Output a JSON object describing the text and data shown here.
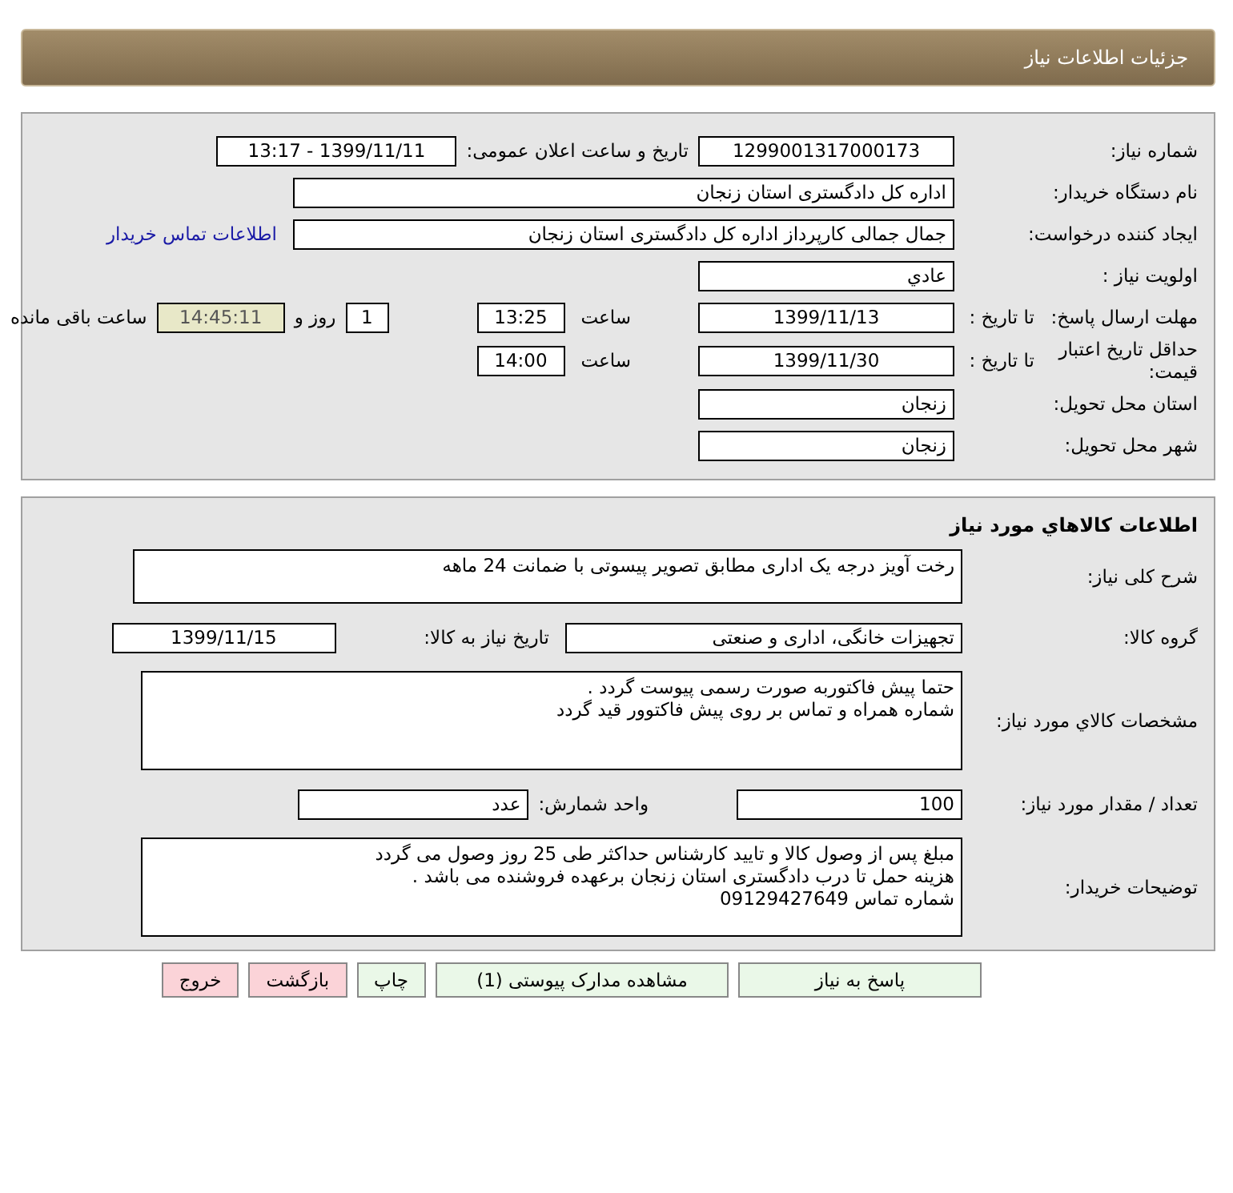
{
  "header": {
    "title": "جزئیات اطلاعات نیاز"
  },
  "general": {
    "need_number": {
      "label": "شماره نیاز:",
      "value": "1299001317000173"
    },
    "announce": {
      "label": "تاریخ و ساعت اعلان عمومی:",
      "value": "1399/11/11 - 13:17"
    },
    "buyer_org": {
      "label": "نام دستگاه خریدار:",
      "value": "اداره کل دادگستری استان زنجان"
    },
    "requester": {
      "label": "ایجاد کننده درخواست:",
      "value": "جمال جمالی کارپرداز اداره کل دادگستری استان زنجان"
    },
    "contact_link": "اطلاعات تماس خریدار",
    "priority": {
      "label": "اولویت نیاز :",
      "value": "عادي"
    },
    "response_deadline": {
      "label": "مهلت ارسال پاسخ:",
      "sublabel": "تا تاریخ :",
      "date": "1399/11/13",
      "time_label": "ساعت",
      "time": "13:25",
      "days": "1",
      "days_label": "روز و",
      "remaining": "14:45:11",
      "remaining_label": "ساعت باقی مانده"
    },
    "price_validity": {
      "label": "حداقل تاریخ اعتبار قیمت:",
      "sublabel": "تا تاریخ :",
      "date": "1399/11/30",
      "time_label": "ساعت",
      "time": "14:00"
    },
    "province": {
      "label": "استان محل تحویل:",
      "value": "زنجان"
    },
    "city": {
      "label": "شهر محل تحویل:",
      "value": "زنجان"
    }
  },
  "goods": {
    "title": "اطلاعات کالاهاي مورد نياز",
    "description": {
      "label": "شرح کلی نیاز:",
      "value": "رخت آویز درجه یک اداری مطابق تصویر پیسوتی با ضمانت 24 ماهه"
    },
    "group": {
      "label": "گروه کالا:",
      "value": "تجهیزات خانگی، اداری و صنعتی"
    },
    "need_date": {
      "label": "تاریخ نیاز به کالا:",
      "value": "1399/11/15"
    },
    "specs": {
      "label": "مشخصات کالاي مورد نياز:",
      "value": "حتما پیش فاکتوربه صورت رسمی پیوست گردد .\nشماره همراه و تماس بر روی پیش فاکتوور  قید گردد"
    },
    "quantity": {
      "label": "تعداد / مقدار مورد نیاز:",
      "value": "100"
    },
    "unit": {
      "label": "واحد شمارش:",
      "value": "عدد"
    },
    "buyer_notes": {
      "label": "توضیحات خریدار:",
      "value": "مبلغ پس از وصول کالا و تایید کارشناس حداکثر طی 25 روز وصول می گردد\nهزینه حمل تا درب دادگستری استان زنجان برعهده فروشنده می باشد .\nشماره تماس 09129427649"
    }
  },
  "buttons": [
    {
      "label": "پاسخ به نیاز",
      "kind": "primary"
    },
    {
      "label": "مشاهده مدارک پیوستی (1)",
      "kind": "primary"
    },
    {
      "label": "چاپ",
      "kind": "primary"
    },
    {
      "label": "بازگشت",
      "kind": "danger"
    },
    {
      "label": "خروج",
      "kind": "danger"
    }
  ]
}
